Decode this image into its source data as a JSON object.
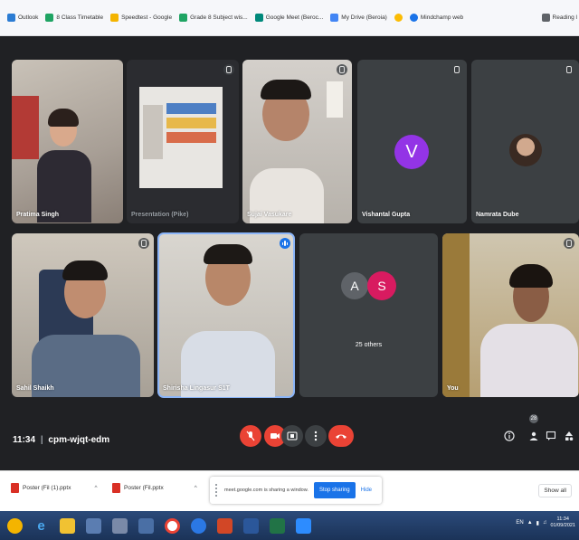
{
  "bookmarks": [
    {
      "label": "Outlook",
      "icon": "outlook-icon",
      "color": "#2b7cd3"
    },
    {
      "label": "8 Class Timetable",
      "icon": "drive-icon",
      "color": "#1fa463"
    },
    {
      "label": "Speedtest - Google",
      "icon": "folder-icon",
      "color": "#f4b400"
    },
    {
      "label": "Grade 8 Subject wis...",
      "icon": "drive-icon",
      "color": "#1fa463"
    },
    {
      "label": "Google Meet (Beroc...",
      "icon": "meet-icon",
      "color": "#00897b"
    },
    {
      "label": "My Drive (Beroia)",
      "icon": "drive-icon",
      "color": "#4285f4"
    },
    {
      "label": "",
      "icon": "chrome-icon",
      "color": "#fbbc04"
    },
    {
      "label": "Mindchamp web",
      "icon": "globe-icon",
      "color": "#1a73e8"
    }
  ],
  "bookmarks_right": "Reading l",
  "participants": [
    {
      "name": "Pratima Singh"
    },
    {
      "name": "Presentation (Pike)"
    },
    {
      "name": "Sujai Vasukare"
    },
    {
      "name": "Vishantal Gupta",
      "initial": "V",
      "avatar_color": "#9334e6"
    },
    {
      "name": "Namrata Dube"
    },
    {
      "name": "Sahil Shaikh"
    },
    {
      "name": "Shirisha Lingasur S1T"
    },
    {
      "name": "25 others",
      "initials": [
        "A",
        "S"
      ],
      "colors": [
        "#5f6368",
        "#d81b60"
      ]
    },
    {
      "name": "You"
    }
  ],
  "meeting": {
    "time": "11:34",
    "separator": "|",
    "code": "cpm-wjqt-edm"
  },
  "controls": [
    {
      "name": "mic-off",
      "icon": "mic-off-icon",
      "color": "#ea4335"
    },
    {
      "name": "camera-off",
      "icon": "camera-off-icon",
      "color": "#ea4335"
    },
    {
      "name": "present",
      "icon": "present-icon",
      "color": "#3c4043"
    },
    {
      "name": "more",
      "icon": "more-vert-icon",
      "color": "#3c4043"
    },
    {
      "name": "leave-call",
      "icon": "call-end-icon",
      "color": "#ea4335"
    }
  ],
  "people_count": "28",
  "downloads": [
    {
      "label": "Poster (Fil (1).pptx"
    },
    {
      "label": "Poster (Fil.pptx"
    }
  ],
  "share": {
    "text": "meet.google.com is sharing a window.",
    "stop_label": "Stop sharing",
    "hide_label": "Hide"
  },
  "show_all": "Show all",
  "tray": {
    "lang": "EN",
    "time": "11:34",
    "date": "01/09/2021"
  }
}
